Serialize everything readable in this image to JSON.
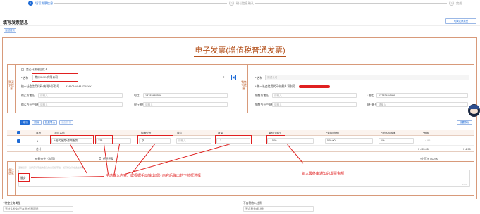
{
  "stepper": {
    "steps": [
      {
        "num": "1",
        "label": "填写发票信息"
      },
      {
        "num": "2",
        "label": "确认信息确认"
      },
      {
        "num": "3",
        "label": "完成"
      }
    ]
  },
  "page_title": "填写发票信息",
  "top_right_button": "切换发票类型",
  "small_blue_button": "返回首页",
  "invoice_title": "电子发票(增值税普通发票)",
  "buyer": {
    "side_label": "购买方信息",
    "natural_person_checkbox": "是否开票给自然人",
    "name_label": "* 名称",
    "name_value": "常州XXXX有限公司",
    "tax_label": "统一社会信用代码/纳税人识别号",
    "tax_value": "91410104MA47X8YY",
    "address_label": "购买方地址",
    "address_placeholder": "请输入",
    "phone_label": "电话",
    "phone_value": "13783484566",
    "bank_label": "购买方开户银行",
    "bank_placeholder": "请输入",
    "account_label": "银行账号",
    "account_placeholder": "请输入"
  },
  "seller": {
    "side_label": "销售方信息",
    "name_label": "* 名称",
    "name_value": "测试公司",
    "tax_label": "* 统一社会信用代码/纳税人识别号",
    "address_label": "销售方地址",
    "address_placeholder": "请输入",
    "phone_label": "* 电话",
    "phone_value": "13783484566",
    "bank_label": "销售方开户银行",
    "bank_placeholder": "请输入",
    "account_label": "银行账号",
    "account_placeholder": "请输入"
  },
  "toolbar": {
    "add": "+ 增行",
    "delete": "删除",
    "import": "批量导入",
    "discount": "添加折扣",
    "right_button": "设置默认"
  },
  "table": {
    "headers": [
      "序号",
      "*项目名称",
      "规格型号",
      "单位",
      "数量",
      "单价(含税)",
      "*金额(含税)",
      "*税率/征收率",
      "*税额"
    ],
    "row": {
      "index": "1",
      "item": "*现代服务*咨询服务",
      "spec_value": "123",
      "unit_value": "次",
      "unit_placeholder": "请输入",
      "qty": "1",
      "price": "500",
      "amount": "500.00",
      "rate": "1%",
      "tax": "4.95"
    },
    "subtotal_label": "合计",
    "subtotal_amount": "¥ 495.05",
    "subtotal_tax": "¥ 4.95",
    "total_label": "价税合计（大写）",
    "total_upper": "伍佰元整",
    "total_small_label": "（小写）",
    "total_small": "¥ 500.00"
  },
  "remarks": {
    "side_label": "备注信息",
    "hint": "温馨提示：选择自动带出的备注信息已经带出，如需修改请在此处修改",
    "value": "服务",
    "counter": "0/200"
  },
  "annotations": {
    "left": "手动输入内容、或根据手动输出部分内容后弹出的下拉框选择",
    "right": "输入最终审通知的发票金额"
  },
  "bottom": {
    "left_label": "* 特定业务类型",
    "left_value": "无特定业务/不含税/应税项目",
    "right_label": "不含税收入比例",
    "right_value": "不含税金额比例"
  },
  "colors": {
    "accent": "#1e6bd6",
    "annotation": "#e02020",
    "invoice_title": "#b5521d",
    "frame": "#d89a7a"
  }
}
